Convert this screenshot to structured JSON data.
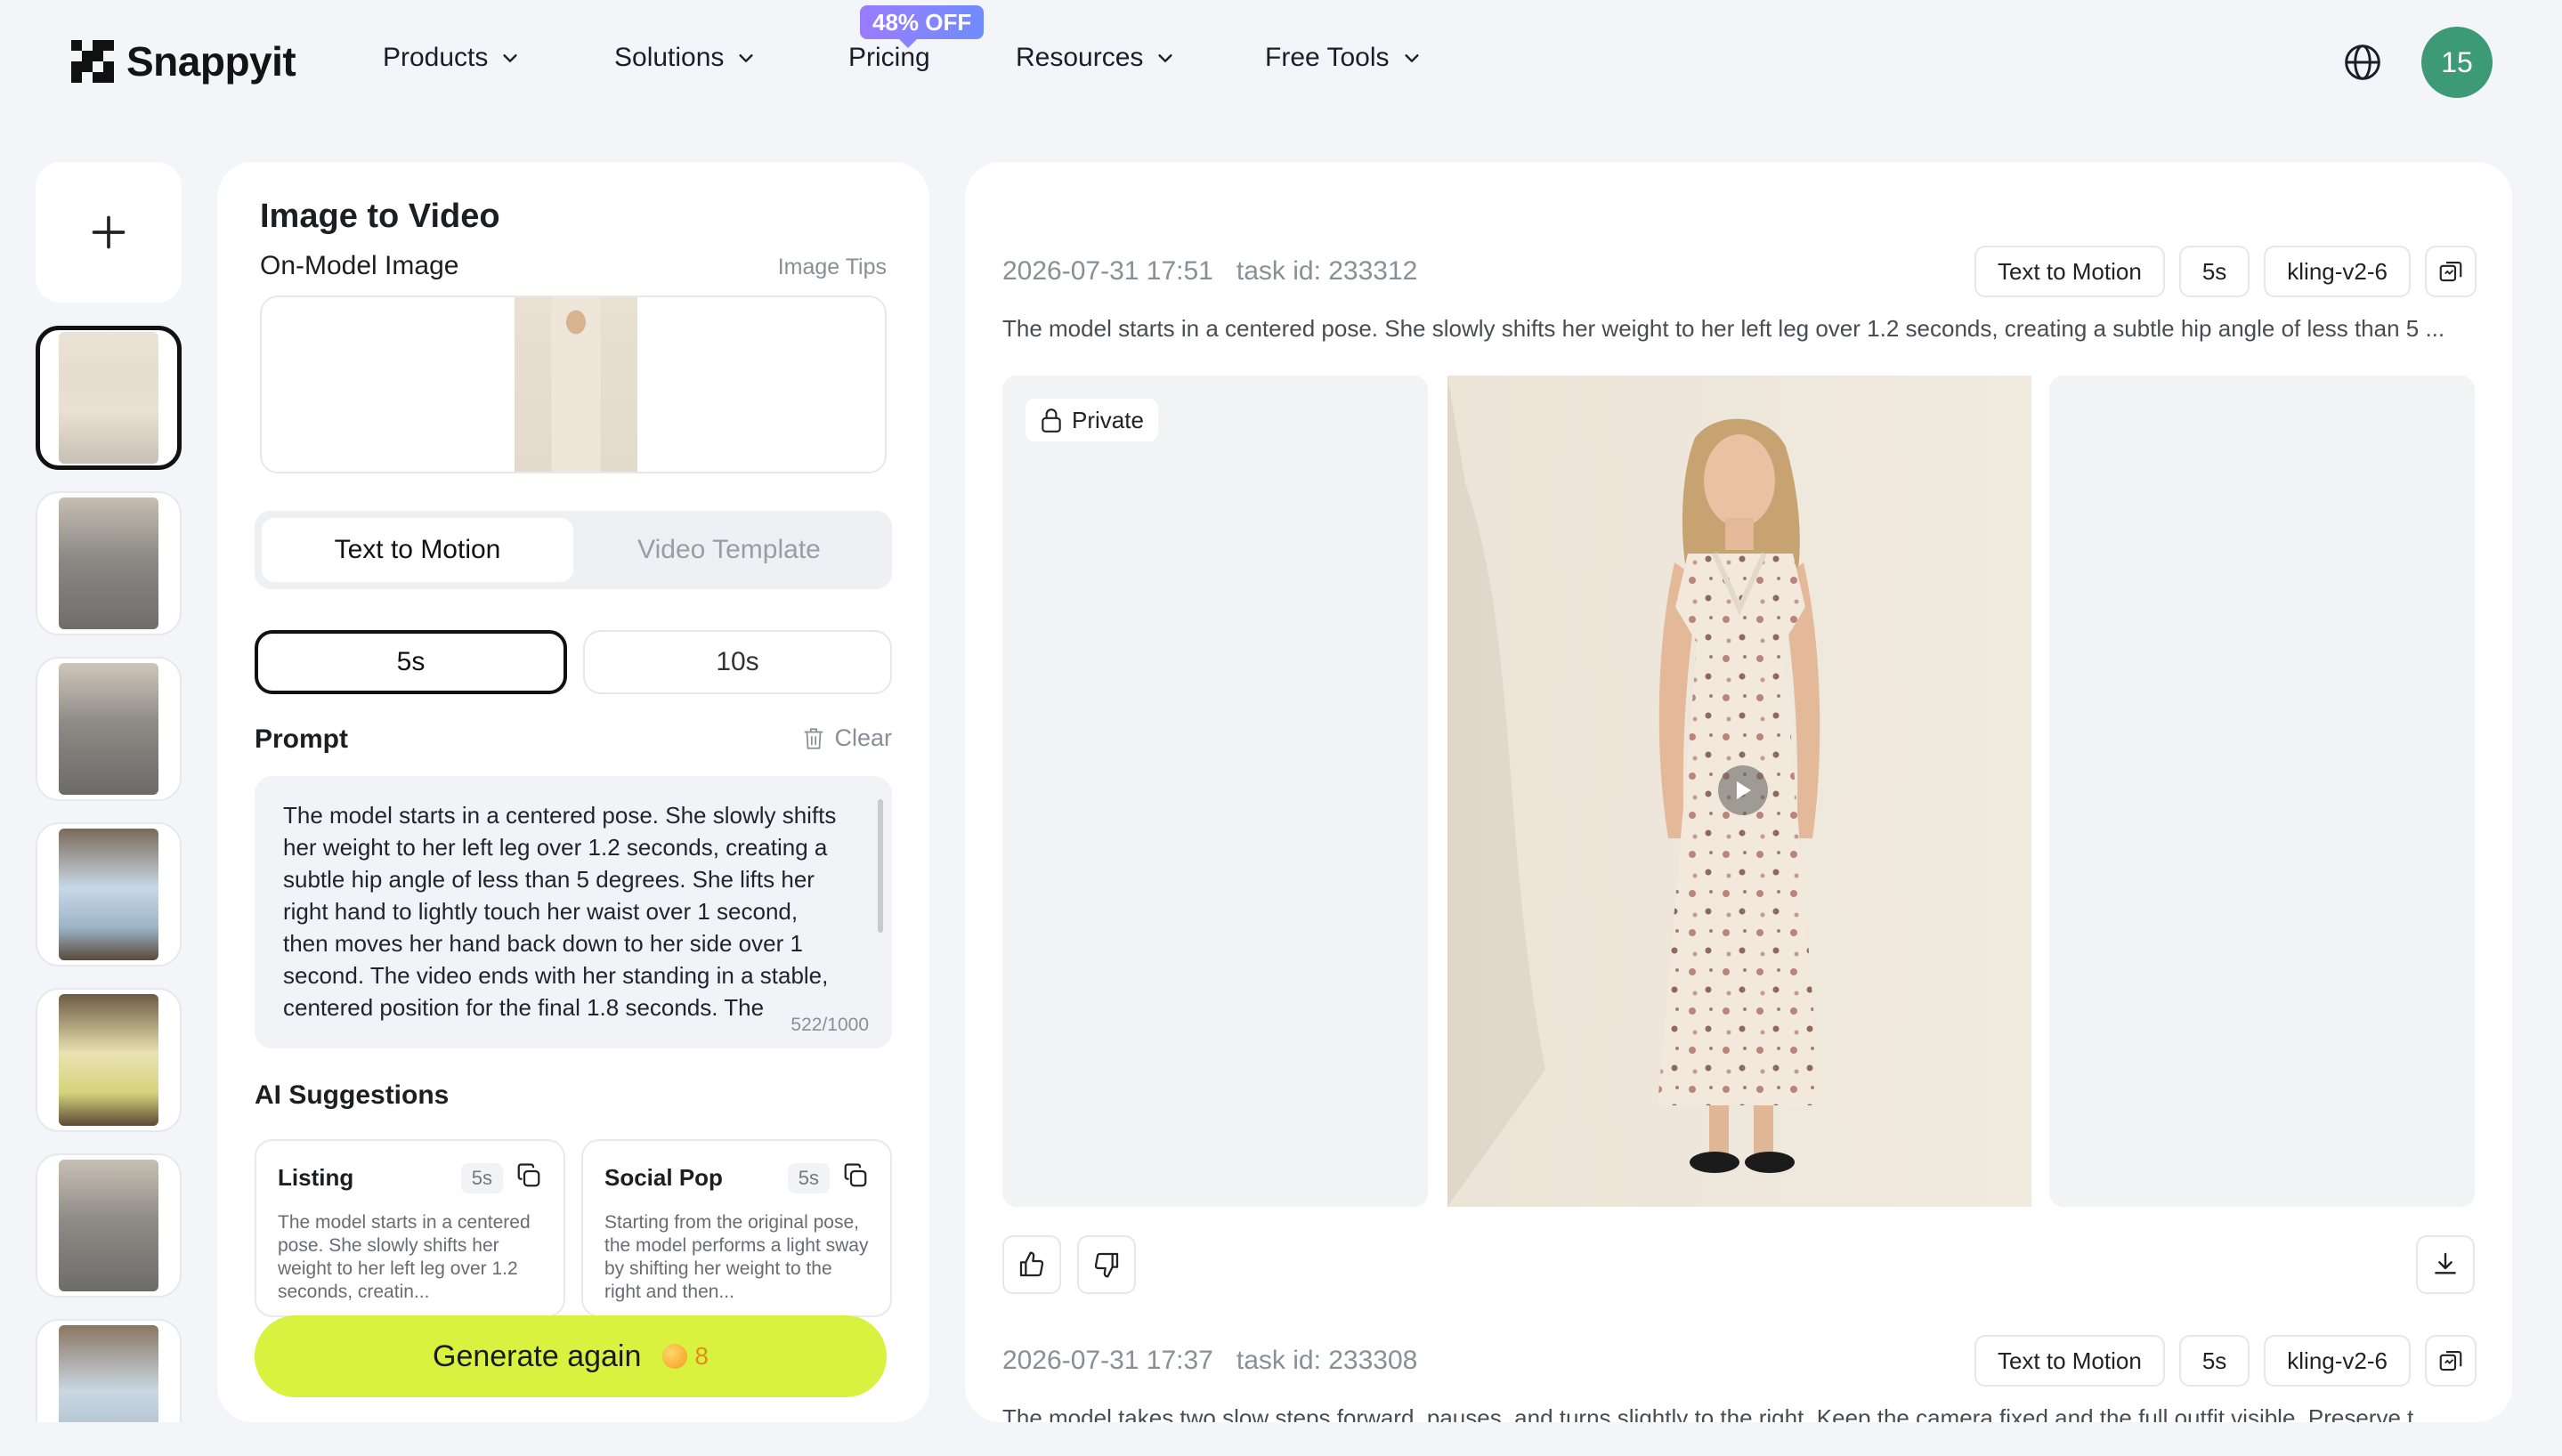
{
  "brand": {
    "name": "Snappyit"
  },
  "nav": {
    "items": [
      {
        "label": "Products",
        "has_dropdown": true
      },
      {
        "label": "Solutions",
        "has_dropdown": true
      },
      {
        "label": "Pricing",
        "has_dropdown": false
      },
      {
        "label": "Resources",
        "has_dropdown": true
      },
      {
        "label": "Free Tools",
        "has_dropdown": true
      }
    ],
    "promo_badge": "48% OFF",
    "language_icon": "globe-icon",
    "avatar_label": "15",
    "avatar_color": "#3d9a77"
  },
  "history": {
    "add_icon": "plus-icon",
    "thumbnails": [
      {
        "desc": "floral dress",
        "active": true
      },
      {
        "desc": "grey jumpsuit",
        "active": false
      },
      {
        "desc": "grey jumpsuit",
        "active": false
      },
      {
        "desc": "blue top denim",
        "active": false
      },
      {
        "desc": "yellow floral dress",
        "active": false
      },
      {
        "desc": "grey jumpsuit",
        "active": false
      },
      {
        "desc": "blue top",
        "active": false
      }
    ]
  },
  "editor": {
    "title": "Image to Video",
    "image_label": "On-Model Image",
    "image_tips": "Image Tips",
    "mode_tabs": [
      {
        "label": "Text to Motion",
        "active": true
      },
      {
        "label": "Video Template",
        "active": false
      }
    ],
    "durations": [
      {
        "label": "5s",
        "active": true
      },
      {
        "label": "10s",
        "active": false
      }
    ],
    "prompt_label": "Prompt",
    "clear_label": "Clear",
    "prompt_text": "The model starts in a centered pose. She slowly shifts her weight to her left leg over 1.2 seconds, creating a subtle hip angle of less than 5 degrees. She lifts her right hand to lightly touch her waist over 1 second, then moves her hand back down to her side over 1 second. The video ends with her standing in a stable, centered position for the final 1.8 seconds. The",
    "char_count": "522/1000",
    "ai_suggestions_label": "AI Suggestions",
    "suggestions": [
      {
        "title": "Listing",
        "duration": "5s",
        "text": "The model starts in a centered pose. She slowly shifts her weight to her left leg over 1.2 seconds, creatin..."
      },
      {
        "title": "Social Pop",
        "duration": "5s",
        "text": "Starting from the original pose, the model performs a light sway by shifting her weight to the right and then..."
      }
    ],
    "generate_label": "Generate again",
    "credit_cost": "8",
    "generate_color": "#d8f23f"
  },
  "results": {
    "tasks": [
      {
        "timestamp": "2026-07-31 17:51",
        "task_id": "task id: 233312",
        "chips": [
          "Text to Motion",
          "5s",
          "kling-v2-6"
        ],
        "prompt": "The model starts in a centered pose. She slowly shifts her weight to her left leg over 1.2 seconds, creating a subtle hip angle of less than 5 ...",
        "visibility": "Private"
      },
      {
        "timestamp": "2026-07-31 17:37",
        "task_id": "task id: 233308",
        "chips": [
          "Text to Motion",
          "5s",
          "kling-v2-6"
        ],
        "prompt": "The model takes two slow steps forward, pauses, and turns slightly to the right. Keep the camera fixed and the full outfit visible. Preserve t"
      }
    ]
  }
}
